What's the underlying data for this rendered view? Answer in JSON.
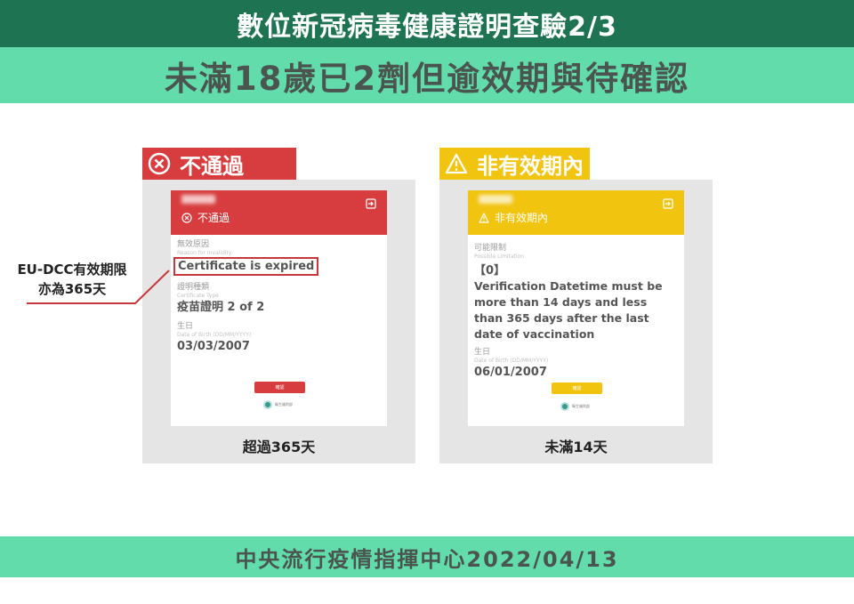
{
  "header": {
    "title": "數位新冠病毒健康證明查驗2/3",
    "subtitle": "未滿18歲已2劑但逾效期與待確認"
  },
  "colors": {
    "header_dark_green": "#1e7452",
    "header_light_green": "#62dcab",
    "fail_red": "#d73d3e",
    "warn_yellow": "#f1c40f",
    "panel_gray": "#e6e5e6"
  },
  "annotation": {
    "line1": "EU-DCC有效期限",
    "line2": "亦為365天"
  },
  "cards": [
    {
      "status_icon": "circle-x-icon",
      "status_label": "不通過",
      "phone": {
        "header_status_icon": "circle-x-icon",
        "header_status": "不通過",
        "exit_icon": "exit-icon",
        "fields": [
          {
            "label_zh": "無效原因",
            "label_en": "Reason for Invalidity",
            "value": "Certificate is expired"
          },
          {
            "label_zh": "證明種類",
            "label_en": "Certificate Type",
            "value": "疫苗證明 2 of 2"
          },
          {
            "label_zh": "生日",
            "label_en": "Date of Birth (DD/MM/YYYY)",
            "value": "03/03/2007"
          }
        ],
        "confirm_button": "確認",
        "logo_text": "衛生福利部"
      },
      "caption": "超過365天"
    },
    {
      "status_icon": "warning-triangle-icon",
      "status_label": "非有效期內",
      "phone": {
        "header_status_icon": "warning-triangle-icon",
        "header_status": "非有效期內",
        "exit_icon": "exit-icon",
        "fields": [
          {
            "label_zh": "可能限制",
            "label_en": "Possible Limitation",
            "code": "【0】",
            "value": "Verification Datetime must be more than 14 days and less than 365 days after the last date of vaccination"
          },
          {
            "label_zh": "生日",
            "label_en": "Date of Birth (DD/MM/YYYY)",
            "value": "06/01/2007"
          }
        ],
        "confirm_button": "確認",
        "logo_text": "衛生福利部"
      },
      "caption": "未滿14天"
    }
  ],
  "footer": {
    "text": "中央流行疫情指揮中心2022/04/13"
  }
}
